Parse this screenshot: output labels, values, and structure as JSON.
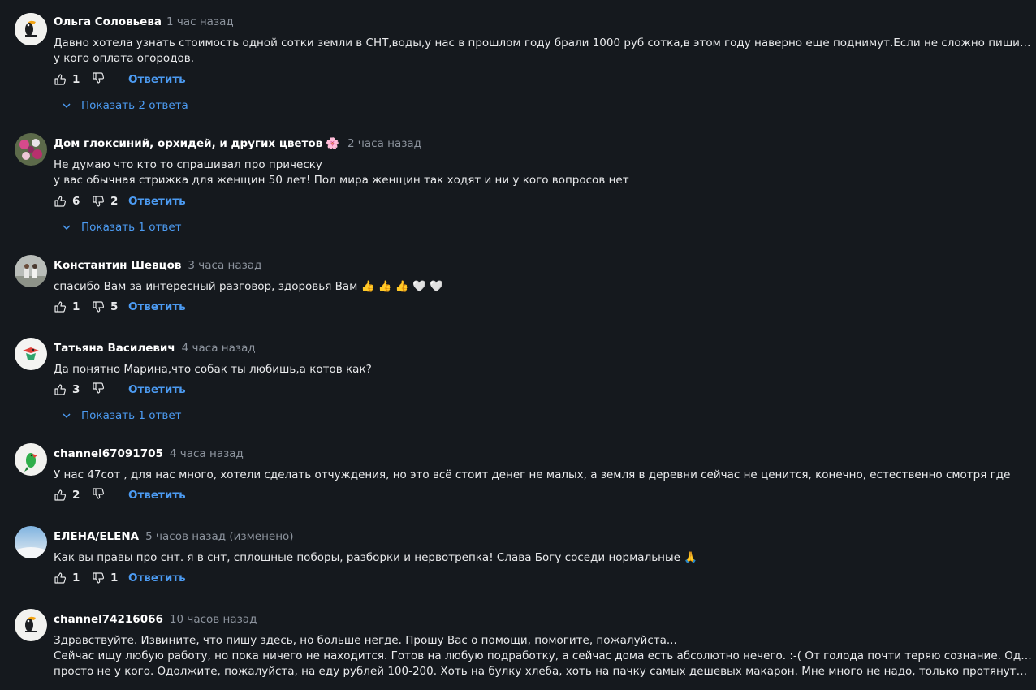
{
  "reply_label": "Ответить",
  "comments": [
    {
      "author": "Ольга Соловьева",
      "time": "1 час назад",
      "lines": [
        "Давно хотела узнать стоимость одной сотки земли в СНТ,воды,у нас в прошлом году брали 1000 руб сотка,в этом году наверно еще поднимут.Если не сложно пишите сколько",
        "у кого оплата огородов."
      ],
      "likes": "1",
      "dislikes": "",
      "show_replies": "Показать 2 ответа",
      "avatar_icon": "toucan-icon"
    },
    {
      "author": "Дом глоксиний, орхидей, и других цветов",
      "author_emoji": "🌸",
      "time": "2 часа назад",
      "lines": [
        "Не думаю что кто то спрашивал про прическу",
        "у вас обычная стрижка для женщин 50 лет! Пол мира женщин так ходят и ни у кого вопросов нет"
      ],
      "likes": "6",
      "dislikes": "2",
      "show_replies": "Показать 1 ответ",
      "avatar_icon": "flowers-photo-icon"
    },
    {
      "author": "Константин Шевцов",
      "time": "3 часа назад",
      "lines": [
        "спасибо Вам за интересный разговор, здоровья Вам 👍 👍 👍 🤍 🤍"
      ],
      "likes": "1",
      "dislikes": "5",
      "show_replies": "",
      "avatar_icon": "people-photo-icon"
    },
    {
      "author": "Татьяна Василевич",
      "time": "4 часа назад",
      "lines": [
        "Да понятно Марина,что собак ты любишь,а котов как?"
      ],
      "likes": "3",
      "dislikes": "",
      "show_replies": "Показать 1 ответ",
      "avatar_icon": "bird-logo-icon"
    },
    {
      "author": "channel67091705",
      "time": "4 часа назад",
      "lines": [
        "У нас 47сот , для нас много, хотели сделать отчуждения, но это всё стоит денег не малых, а земля в деревни сейчас не ценится, конечно, естественно смотря где"
      ],
      "likes": "2",
      "dislikes": "",
      "show_replies": "",
      "avatar_icon": "parrot-icon"
    },
    {
      "author": "ЕЛЕНА/ELENA",
      "time": "5 часов назад (изменено)",
      "lines": [
        "Как вы правы про снт. я в снт, сплошные поборы, разборки и нервотрепка! Слава Богу соседи нормальные 🙏"
      ],
      "likes": "1",
      "dislikes": "1",
      "show_replies": "",
      "avatar_icon": "sky-photo-icon"
    },
    {
      "author": "channel74216066",
      "time": "10 часов назад",
      "lines": [
        "Здравствуйте. Извините, что пишу здесь, но больше негде. Прошу Вас о помощи, помогите, пожалуйста...",
        "Сейчас ищу любую работу, но пока ничего не находится. Готов на любую подработку, а сейчас дома есть абсолютно нечего. :-( От голода почти теряю сознание. Одолжить",
        "просто не у кого. Одолжите, пожалуйста, на еду рублей 100-200. Хоть на булку хлеба, хоть на пачку самых дешевых макарон. Мне много не надо, только протянуть несколько..."
      ],
      "likes": "",
      "dislikes": "",
      "show_replies": "",
      "avatar_icon": "toucan-icon"
    }
  ]
}
